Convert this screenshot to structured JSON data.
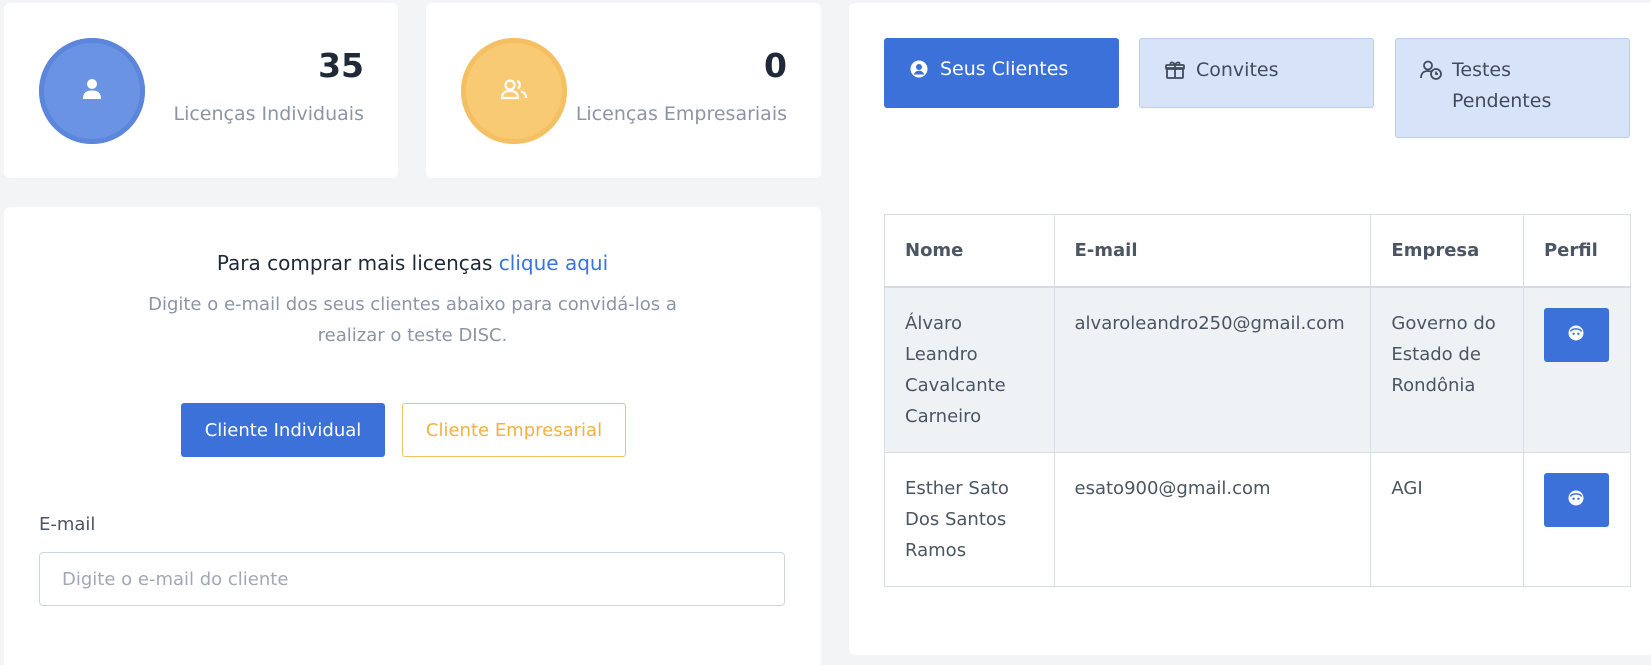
{
  "stats": {
    "individual": {
      "value": "35",
      "label": "Licenças Individuais",
      "icon": "user-icon",
      "color": "#6a93e3"
    },
    "empresa": {
      "value": "0",
      "label": "Licenças Empresariais",
      "icon": "users-icon",
      "color": "#f8ca74"
    }
  },
  "invite": {
    "heading": "Para comprar mais licenças",
    "heading_link": "clique aqui",
    "description": "Digite o e-mail dos seus clientes abaixo para convidá-los a realizar o teste DISC.",
    "individual_button": "Cliente Individual",
    "empresarial_button": "Cliente Empresarial",
    "email_label": "E-mail",
    "email_placeholder": "Digite o e-mail do cliente",
    "email_value": ""
  },
  "tabs": [
    {
      "label": "Seus Clientes",
      "icon": "user-circle-icon",
      "active": true
    },
    {
      "label": "Convites",
      "icon": "gift-icon",
      "active": false
    },
    {
      "label": "Testes Pendentes",
      "icon": "user-clock-icon",
      "active": false
    }
  ],
  "table": {
    "headers": [
      "Nome",
      "E-mail",
      "Empresa",
      "Perfil"
    ],
    "rows": [
      {
        "nome": "Álvaro Leandro Cavalcante Carneiro",
        "email": "alvaroleandro250@gmail.com",
        "empresa": "Governo do Estado de Rondônia",
        "perfil_icon": "face-icon"
      },
      {
        "nome": "Esther Sato Dos Santos Ramos",
        "email": "esato900@gmail.com",
        "empresa": "AGI",
        "perfil_icon": "face-icon"
      }
    ]
  },
  "colors": {
    "primary": "#3b71d9",
    "warning": "#f2b140",
    "tab_inactive": "#d7e3f9"
  }
}
